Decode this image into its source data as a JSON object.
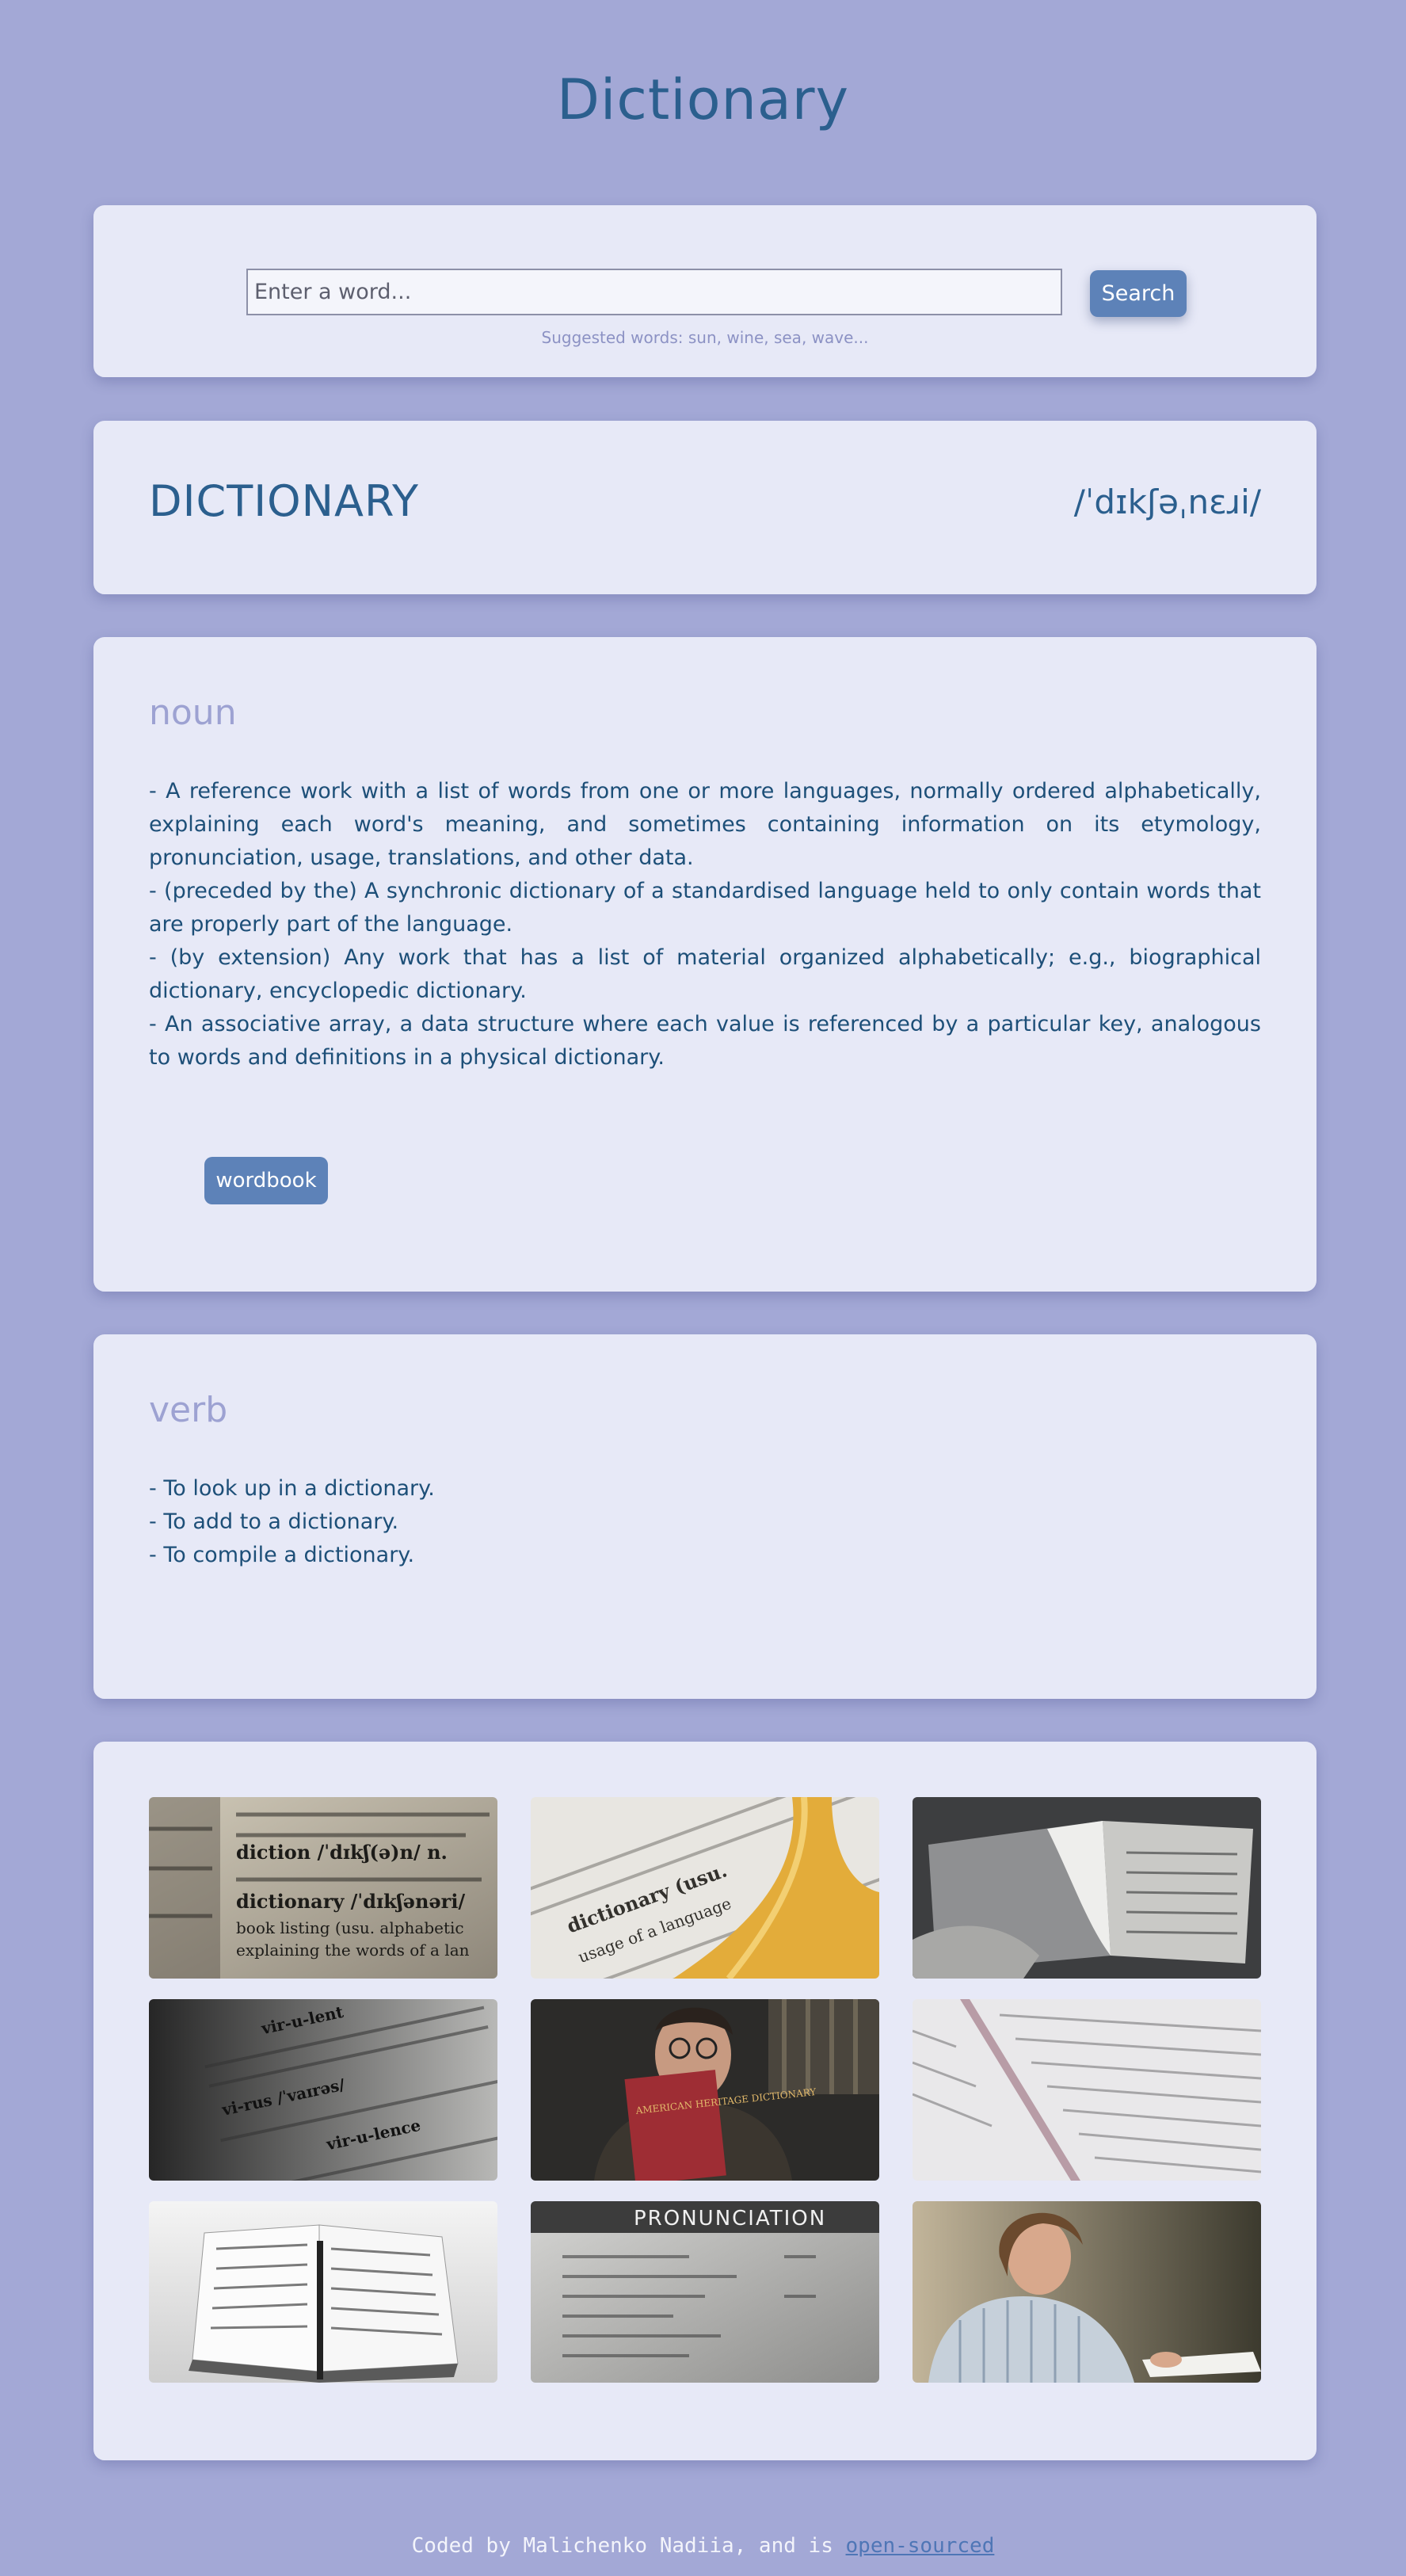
{
  "app_title": "Dictionary",
  "search": {
    "placeholder": "Enter a word...",
    "button_label": "Search",
    "suggestions": "Suggested words: sun, wine, sea, wave..."
  },
  "word": {
    "title": "DICTIONARY",
    "phonetic": "/ˈdɪkʃəˌnɛɹi/"
  },
  "meanings": [
    {
      "part_of_speech": "noun",
      "definitions": [
        "- A reference work with a list of words from one or more languages, normally ordered alphabetically, explaining each word's meaning, and sometimes containing information on its etymology, pronunciation, usage, translations, and other data.",
        "- (preceded by the) A synchronic dictionary of a standardised language held to only contain words that are properly part of the language.",
        "- (by extension) Any work that has a list of material organized alphabetically; e.g., biographical dictionary, encyclopedic dictionary.",
        "- An associative array, a data structure where each value is referenced by a particular key, analogous to words and definitions in a physical dictionary."
      ],
      "synonym": "wordbook"
    },
    {
      "part_of_speech": "verb",
      "definitions": [
        "- To look up in a dictionary.",
        "- To add to a dictionary.",
        "- To compile a dictionary."
      ]
    }
  ],
  "photos": [
    {
      "subject": "dictionary page closeup diction"
    },
    {
      "subject": "dictionary page with yellow tassel"
    },
    {
      "subject": "hand flipping dictionary pages"
    },
    {
      "subject": "virulence dictionary page dark"
    },
    {
      "subject": "man holding american heritage dictionary"
    },
    {
      "subject": "open dictionary pages light"
    },
    {
      "subject": "open book with pen"
    },
    {
      "subject": "pronunciation page"
    },
    {
      "subject": "woman reading at desk"
    }
  ],
  "photo_texts": {
    "p1": [
      "diction /ˈdɪkʃ(ə)n/ n.",
      "dictionary /ˈdɪkʃənəri/",
      "book listing (usu. alphabetic",
      "explaining the words of a lan"
    ],
    "p2": [
      "dictionary (usu.",
      "usage of a language"
    ],
    "p4": [
      "vir-u-lent",
      "vi-rus /ˈvaɪrəs/",
      "vir-u-lence"
    ],
    "p5": "AMERICAN HERITAGE DICTIONARY",
    "p8": "PRONUNCIATION"
  },
  "footer": {
    "text": "Coded by Malichenko Nadiia, and is ",
    "link_label": "open-sourced"
  },
  "colors": {
    "background": "#a3a8d6",
    "card": "#e7e9f7",
    "heading": "#2b5f8e",
    "accent_button": "#5d82b8",
    "muted_heading": "#9da2d2"
  }
}
